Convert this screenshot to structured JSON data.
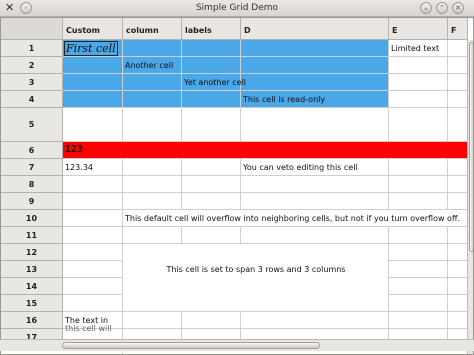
{
  "window": {
    "title": "Simple Grid Demo"
  },
  "columns": [
    "Custom",
    "column",
    "labels",
    "D",
    "E",
    "F"
  ],
  "rows": [
    "1",
    "2",
    "3",
    "4",
    "5",
    "6",
    "7",
    "8",
    "9",
    "10",
    "11",
    "12",
    "13",
    "14",
    "15",
    "16",
    "17"
  ],
  "cells": {
    "r1_custom": "First cell",
    "r1_e": "Limited text",
    "r2_column": "Another cell",
    "r3_labels": "Yet another cell",
    "r4_d": "This cell is read-only",
    "r6_custom": "123",
    "r7_custom": "123.34",
    "r7_d": "You can veto editing this cell",
    "r10_column": "This default cell will overflow into neighboring cells, but not if you turn overflow off.",
    "span_text": "This cell is set to span 3 rows and 3 columns",
    "r16_custom": "The text in",
    "r17_custom": "this cell will"
  },
  "colors": {
    "selection_blue": "#4aa7e8",
    "red_row": "#ff0000"
  }
}
